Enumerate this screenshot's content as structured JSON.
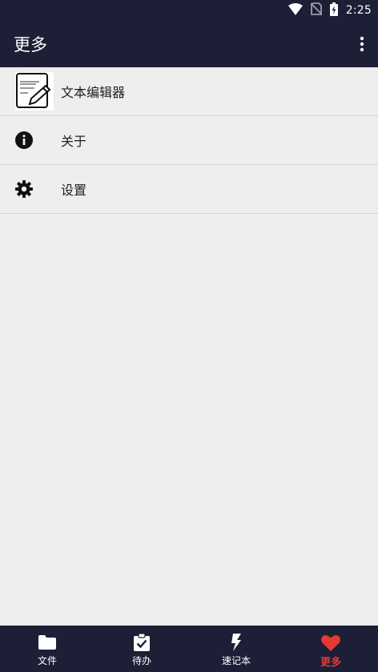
{
  "status": {
    "time": "2:25"
  },
  "appbar": {
    "title": "更多"
  },
  "list": [
    {
      "label": "文本编辑器",
      "icon": "text-editor-icon"
    },
    {
      "label": "关于",
      "icon": "info-icon"
    },
    {
      "label": "设置",
      "icon": "gear-icon"
    }
  ],
  "nav": [
    {
      "label": "文件",
      "icon": "folder-icon"
    },
    {
      "label": "待办",
      "icon": "clipboard-check-icon"
    },
    {
      "label": "速记本",
      "icon": "lightning-icon"
    },
    {
      "label": "更多",
      "icon": "heart-icon",
      "active": true
    }
  ],
  "colors": {
    "bar": "#1c1f36",
    "background": "#eeeeee",
    "accent": "#e53935"
  }
}
